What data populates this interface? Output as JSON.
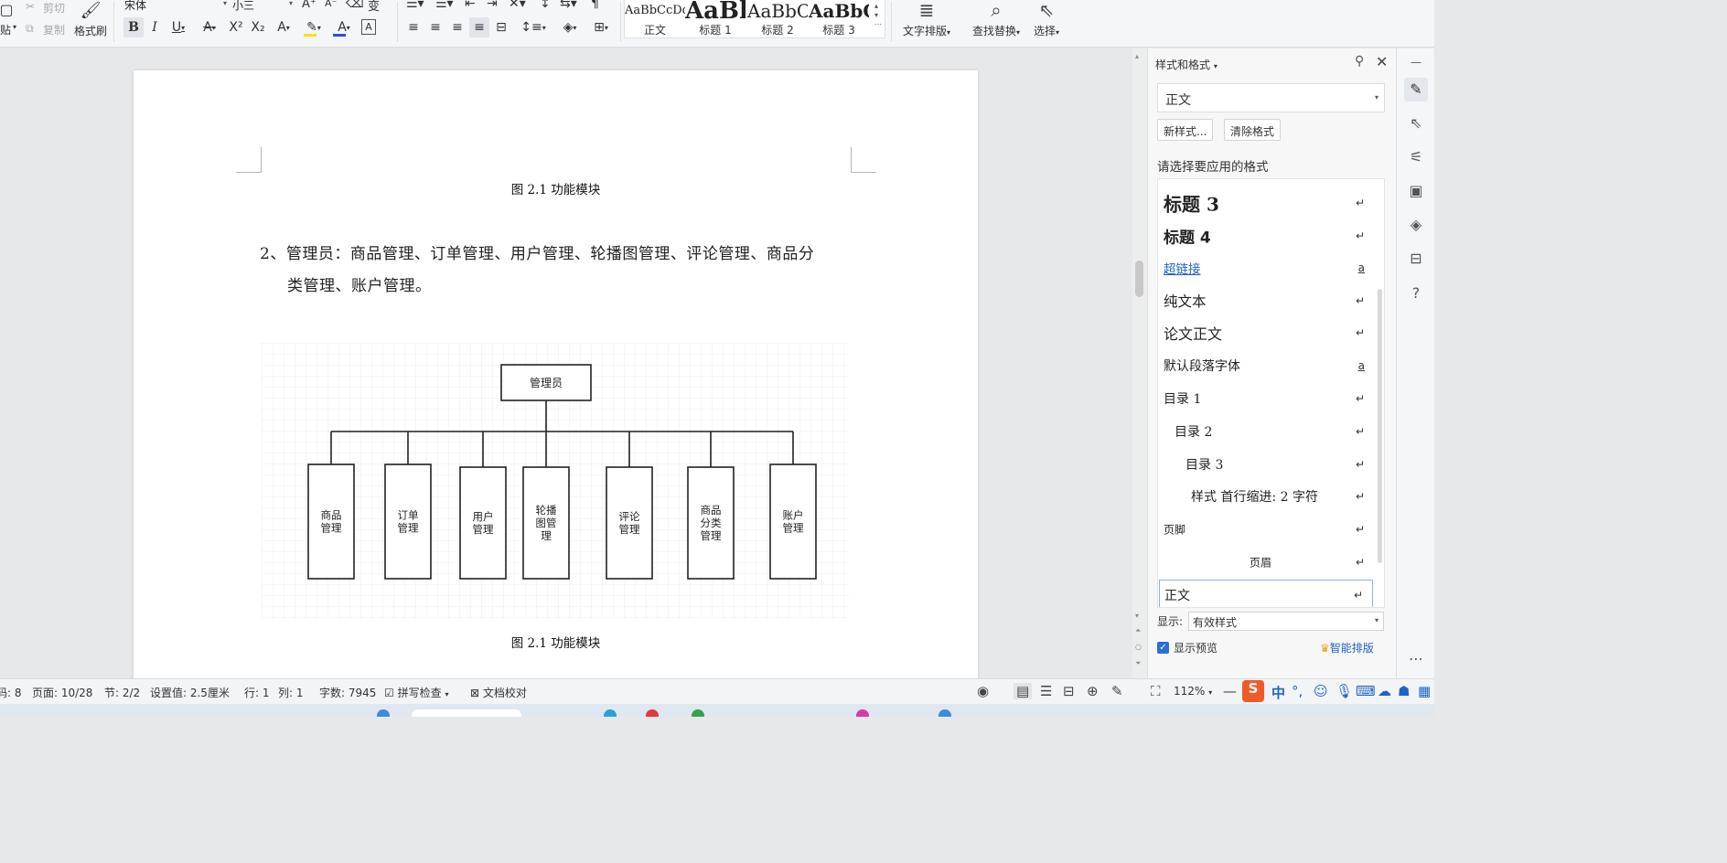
{
  "ribbon": {
    "paste_label": "贴",
    "cut_label": "剪切",
    "copy_label": "复制",
    "format_painter_label": "格式刷",
    "font_name": "宋体",
    "font_size": "小三",
    "styles": [
      {
        "sample": "AaBbCcDd",
        "label": "正文"
      },
      {
        "sample": "AaBl",
        "label": "标题 1"
      },
      {
        "sample": "AaBbC",
        "label": "标题 2"
      },
      {
        "sample": "AaBbC",
        "label": "标题 3"
      }
    ],
    "text_layout_label": "文字排版",
    "find_replace_label": "查找替换",
    "select_label": "选择"
  },
  "document": {
    "top_caption": "图 2.1  功能模块",
    "paragraph_line1": "2、管理员：商品管理、订单管理、用户管理、轮播图管理、评论管理、商品分",
    "paragraph_line2": "类管理、账户管理。",
    "bottom_caption": "图 2.1  功能模块",
    "diagram": {
      "root": "管理员",
      "children": [
        [
          "商品",
          "管理"
        ],
        [
          "订单",
          "管理"
        ],
        [
          "用户",
          "管理"
        ],
        [
          "轮播",
          "图管",
          "理"
        ],
        [
          "评论",
          "管理"
        ],
        [
          "商品",
          "分类",
          "管理"
        ],
        [
          "账户",
          "管理"
        ]
      ]
    }
  },
  "pane": {
    "title": "样式和格式",
    "current_style": "正文",
    "new_style_button": "新样式...",
    "clear_format_button": "清除格式",
    "choose_label": "请选择要应用的格式",
    "items": [
      {
        "name": "标题  3",
        "marker": "↵"
      },
      {
        "name": "标题  4",
        "marker": "↵"
      },
      {
        "name": "超链接",
        "marker": "a"
      },
      {
        "name": "纯文本",
        "marker": "↵"
      },
      {
        "name": "论文正文",
        "marker": "↵"
      },
      {
        "name": "默认段落字体",
        "marker": "a"
      },
      {
        "name": "目录 1",
        "marker": "↵"
      },
      {
        "name": "目录 2",
        "marker": "↵"
      },
      {
        "name": "目录 3",
        "marker": "↵"
      },
      {
        "name": "样式 首行缩进:   2 字符",
        "marker": "↵"
      },
      {
        "name": "页脚",
        "marker": "↵"
      },
      {
        "name": "页眉",
        "marker": "↵"
      },
      {
        "name": "正文",
        "marker": "↵"
      }
    ],
    "show_label": "显示:",
    "show_value": "有效样式",
    "preview_label": "显示预览",
    "smart_layout_label": "智能排版"
  },
  "statusbar": {
    "code": "码: 8",
    "page": "页面: 10/28",
    "section": "节: 2/2",
    "setting": "设置值: 2.5厘米",
    "row": "行: 1",
    "col": "列: 1",
    "words": "字数: 7945",
    "spell_check": "拼写检查",
    "proofread": "文档校对",
    "zoom": "112%",
    "ime": "中"
  },
  "colors": {
    "accent": "#2b6fd6",
    "link": "#2262c6",
    "font_color_bar": "#2e4fd8",
    "highlight_bar": "#f5e21b"
  }
}
